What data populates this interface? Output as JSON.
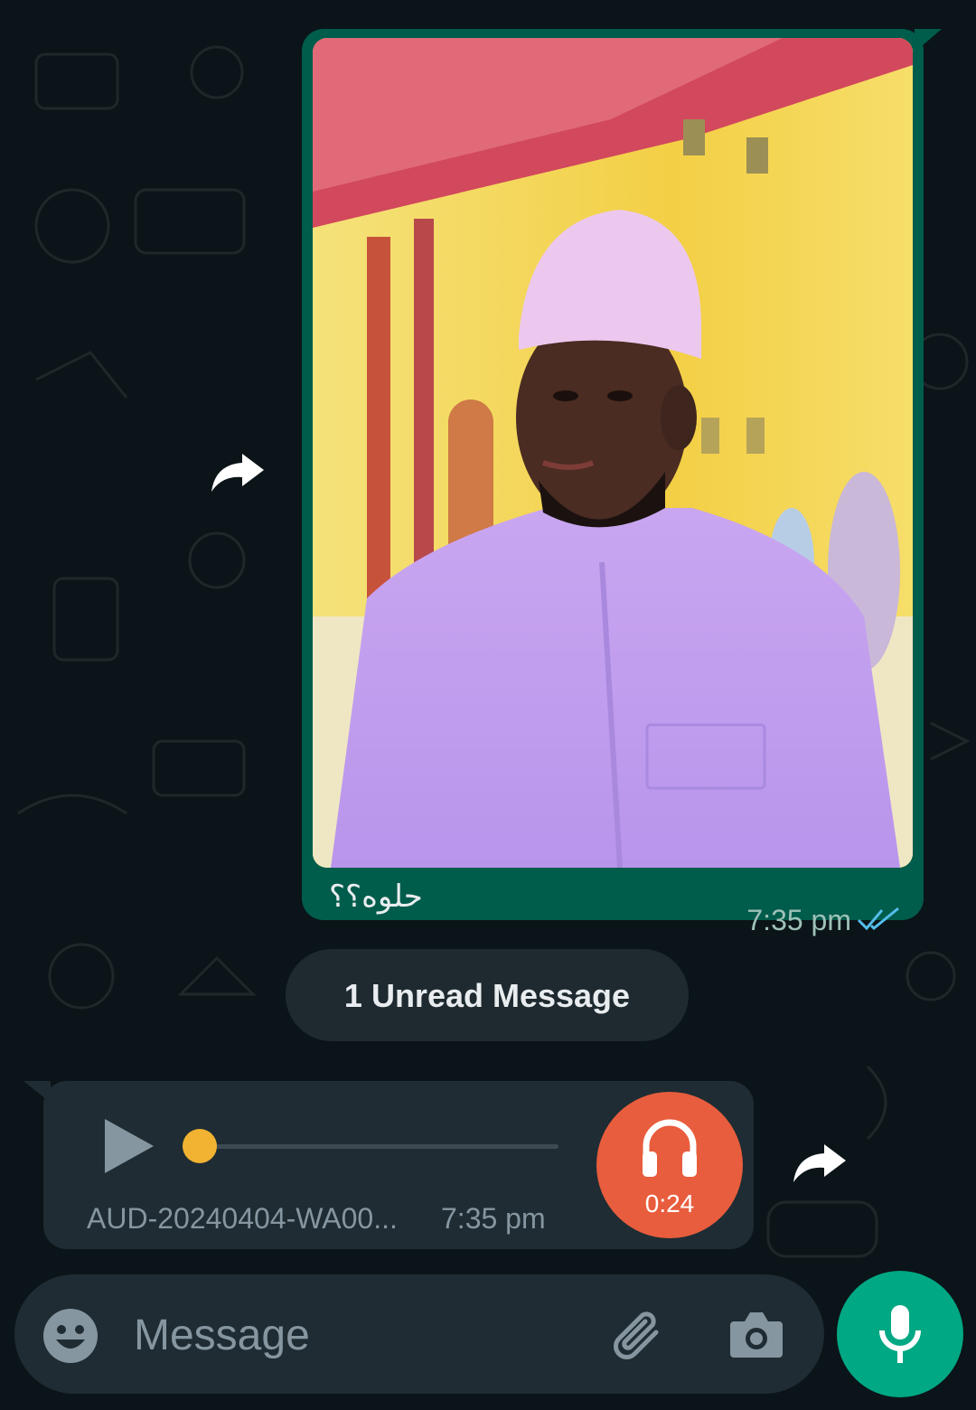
{
  "colors": {
    "background": "#0b1418",
    "outgoing_bubble": "#005c4b",
    "incoming_bubble": "#1f2c33",
    "read_ticks": "#53bdeb",
    "audio_avatar": "#e85d3d",
    "send_button": "#00a884"
  },
  "image_message": {
    "caption": "حلوه؟؟",
    "time": "7:35 pm",
    "status_icon": "double-check-read-icon"
  },
  "unread_divider": {
    "label": "1 Unread Message"
  },
  "audio_message": {
    "filename": "AUD-20240404-WA00...",
    "time": "7:35 pm",
    "duration": "0:24",
    "progress": 0,
    "icons": [
      "play-icon",
      "headphones-icon"
    ]
  },
  "composer": {
    "placeholder": "Message",
    "icons": [
      "emoji-icon",
      "attach-icon",
      "camera-icon",
      "mic-icon"
    ]
  },
  "forward_icons": [
    "forward-icon",
    "forward-icon"
  ]
}
